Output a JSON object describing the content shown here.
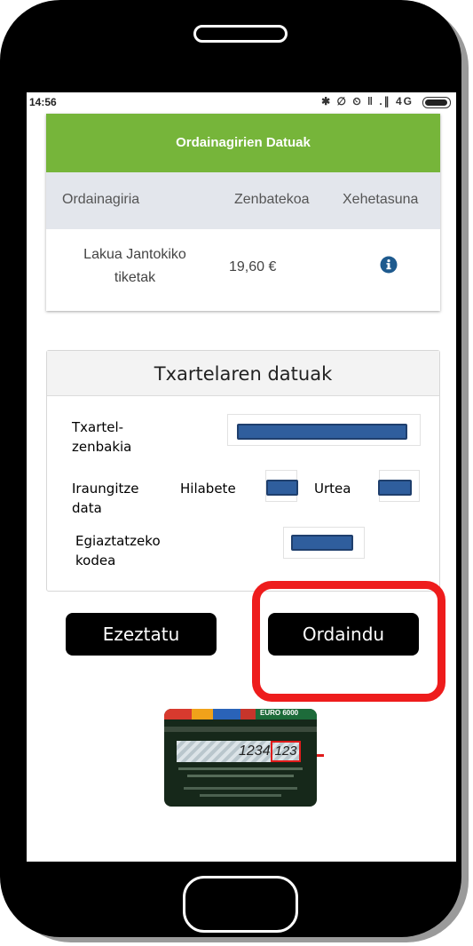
{
  "status_bar": {
    "time": "14:56",
    "icons_text": "✱ ∅ ⏲ ‖ .∥ 4G",
    "network": "4G"
  },
  "receipts": {
    "header": "Ordainagirien Datuak",
    "columns": [
      "Ordainagiria",
      "Zenbatekoa",
      "Xehetasuna"
    ],
    "rows": [
      {
        "name": "Lakua Jantokiko tiketak",
        "amount": "19,60 €",
        "detail_icon": "info-circle-icon"
      }
    ],
    "header_color": "#76b53a"
  },
  "card_form": {
    "title": "Txartelaren datuak",
    "card_number_label": "Txartel-zenbakia",
    "expiry_label": "Iraungitze data",
    "month_label": "Hilabete",
    "year_label": "Urtea",
    "cvv_label": "Egiaztatzeko kodea"
  },
  "actions": {
    "cancel_label": "Ezeztatu",
    "pay_label": "Ordaindu",
    "highlight_color": "#ee1c1c"
  },
  "card_image": {
    "brand": "EURO 6000",
    "number_sample": "1234",
    "cvv_sample": "123"
  }
}
